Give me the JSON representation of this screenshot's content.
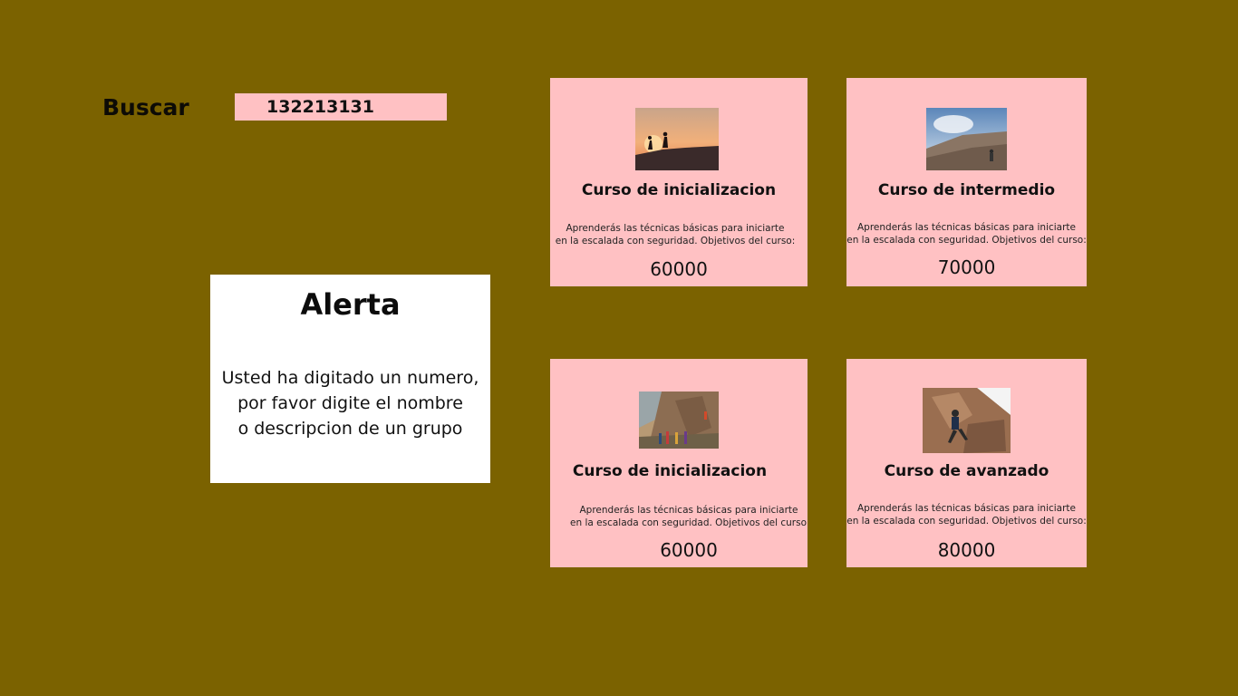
{
  "search": {
    "label": "Buscar",
    "value": "132213131"
  },
  "alert": {
    "title": "Alerta",
    "lines": [
      "Usted ha digitado un numero,",
      "por favor digite el nombre",
      "o descripcion de un grupo"
    ]
  },
  "courses": [
    {
      "title": "Curso de inicializacion",
      "desc_lines": [
        "Aprenderás las técnicas básicas para iniciarte",
        "en la escalada con seguridad. Objetivos del curso:"
      ],
      "price": "60000",
      "image_icon": "hikers-sunset-photo"
    },
    {
      "title": "Curso de intermedio",
      "desc_lines": [
        "Aprenderás las técnicas básicas para iniciarte",
        "en la escalada con seguridad. Objetivos del curso:"
      ],
      "price": "70000",
      "image_icon": "rock-slab-sky-photo"
    },
    {
      "title": "Curso de  inicializacion",
      "desc_lines": [
        "Aprenderás las técnicas básicas para iniciarte",
        "en la escalada con seguridad. Objetivos del curso:"
      ],
      "price": "60000",
      "image_icon": "group-climbing-wall-photo"
    },
    {
      "title": "Curso de  avanzado",
      "desc_lines": [
        "Aprenderás las técnicas básicas para iniciarte",
        "en la escalada con seguridad. Objetivos del curso:"
      ],
      "price": "80000",
      "image_icon": "climber-rock-face-photo"
    }
  ],
  "colors": {
    "background": "#7b6200",
    "card": "#ffc1c3",
    "input": "#ffc1c3",
    "alert": "#ffffff"
  }
}
